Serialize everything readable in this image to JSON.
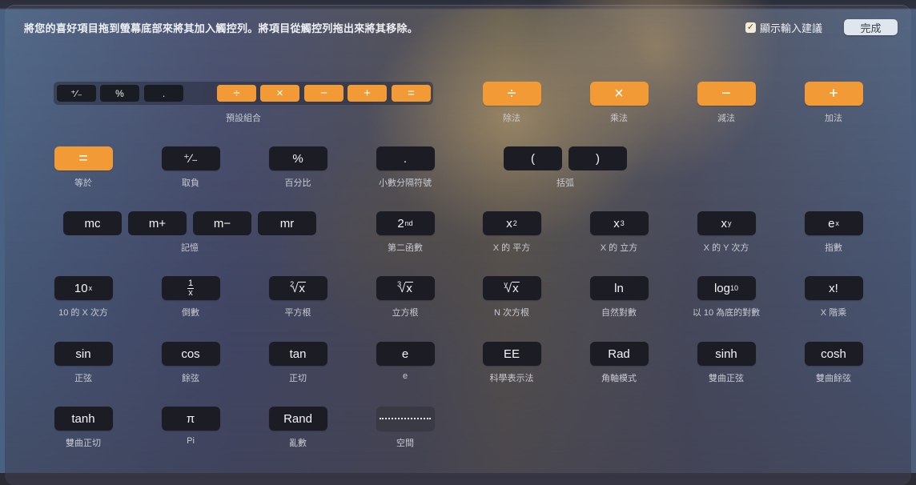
{
  "header": {
    "instruction": "將您的喜好項目拖到螢幕底部來將其加入觸控列。將項目從觸控列拖出來將其移除。",
    "suggestions_label": "顯示輸入建議",
    "suggestions_checked": true,
    "done_label": "完成"
  },
  "colors": {
    "accent_orange": "#f29b36",
    "key_dark": "#1c1d24",
    "done_button": "#dfe6ee"
  },
  "preset": {
    "caption": "預設組合",
    "keys": [
      "⁺∕₋",
      "%",
      ".",
      "÷",
      "×",
      "−",
      "+",
      "="
    ]
  },
  "items": {
    "divide": {
      "key": "÷",
      "caption": "除法"
    },
    "multiply": {
      "key": "×",
      "caption": "乘法"
    },
    "subtract": {
      "key": "−",
      "caption": "減法"
    },
    "add": {
      "key": "+",
      "caption": "加法"
    },
    "equals": {
      "key": "=",
      "caption": "等於"
    },
    "negate": {
      "key": "⁺∕₋",
      "caption": "取負"
    },
    "percent": {
      "key": "%",
      "caption": "百分比"
    },
    "decimal": {
      "key": ".",
      "caption": "小數分隔符號"
    },
    "parens": {
      "open": "(",
      "close": ")",
      "caption": "括弧"
    },
    "memory": {
      "keys": [
        "mc",
        "m+",
        "m−",
        "mr"
      ],
      "caption": "記憶"
    },
    "second": {
      "base": "2",
      "sup": "nd",
      "caption": "第二函數"
    },
    "square": {
      "base": "x",
      "sup": "2",
      "caption": "X 的 平方"
    },
    "cube": {
      "base": "x",
      "sup": "3",
      "caption": "X 的 立方"
    },
    "power": {
      "base": "x",
      "sup": "y",
      "caption": "X 的 Y 次方"
    },
    "exp": {
      "base": "e",
      "sup": "x",
      "caption": "指數"
    },
    "ten_power": {
      "base": "10",
      "sup": "x",
      "caption": "10 的 X 次方"
    },
    "reciprocal": {
      "num": "1",
      "den": "x",
      "caption": "倒數"
    },
    "sqrt": {
      "index": "2",
      "radicand": "x",
      "caption": "平方根"
    },
    "cbrt": {
      "index": "3",
      "radicand": "x",
      "caption": "立方根"
    },
    "nroot": {
      "index": "y",
      "radicand": "x",
      "caption": "N 次方根"
    },
    "ln": {
      "key": "ln",
      "caption": "自然對數"
    },
    "log10": {
      "base": "log",
      "sub": "10",
      "caption": "以 10 為底的對數"
    },
    "factorial": {
      "key": "x!",
      "caption": "X 階乘"
    },
    "sin": {
      "key": "sin",
      "caption": "正弦"
    },
    "cos": {
      "key": "cos",
      "caption": "餘弦"
    },
    "tan": {
      "key": "tan",
      "caption": "正切"
    },
    "e": {
      "key": "e",
      "caption": "e"
    },
    "ee": {
      "key": "EE",
      "caption": "科學表示法"
    },
    "rad": {
      "key": "Rad",
      "caption": "角軸模式"
    },
    "sinh": {
      "key": "sinh",
      "caption": "雙曲正弦"
    },
    "cosh": {
      "key": "cosh",
      "caption": "雙曲餘弦"
    },
    "tanh": {
      "key": "tanh",
      "caption": "雙曲正切"
    },
    "pi": {
      "key": "π",
      "caption": "Pi"
    },
    "rand": {
      "key": "Rand",
      "caption": "亂數"
    },
    "space": {
      "caption": "空間"
    }
  }
}
